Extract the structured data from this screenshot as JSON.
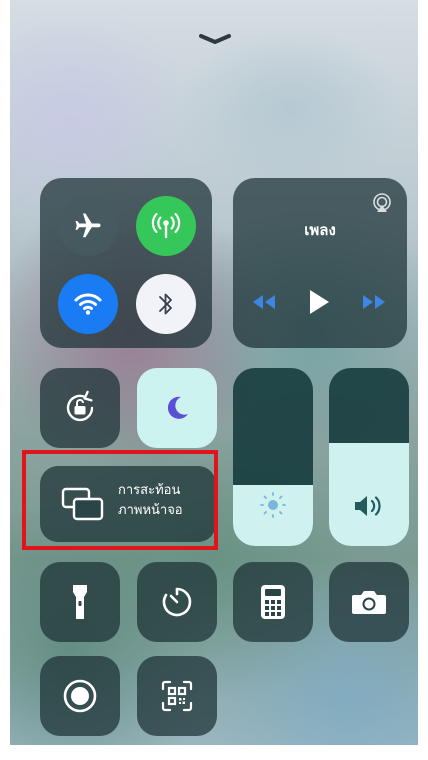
{
  "control_center": {
    "music": {
      "title": "เพลง"
    },
    "screen_mirroring": {
      "line1": "การสะท้อน",
      "line2": "ภาพหน้าจอ"
    },
    "connectivity": {
      "airplane": "airplane-icon",
      "cellular": "cellular-data-icon",
      "wifi": "wifi-icon",
      "bluetooth": "bluetooth-icon"
    },
    "sliders": {
      "brightness": 0.34,
      "volume": 0.58
    },
    "colors": {
      "cellular_active": "#35c759",
      "wifi_active": "#1a7cf5",
      "dnd_active": "#cdf3f0",
      "highlight_box": "#e0141b"
    }
  }
}
